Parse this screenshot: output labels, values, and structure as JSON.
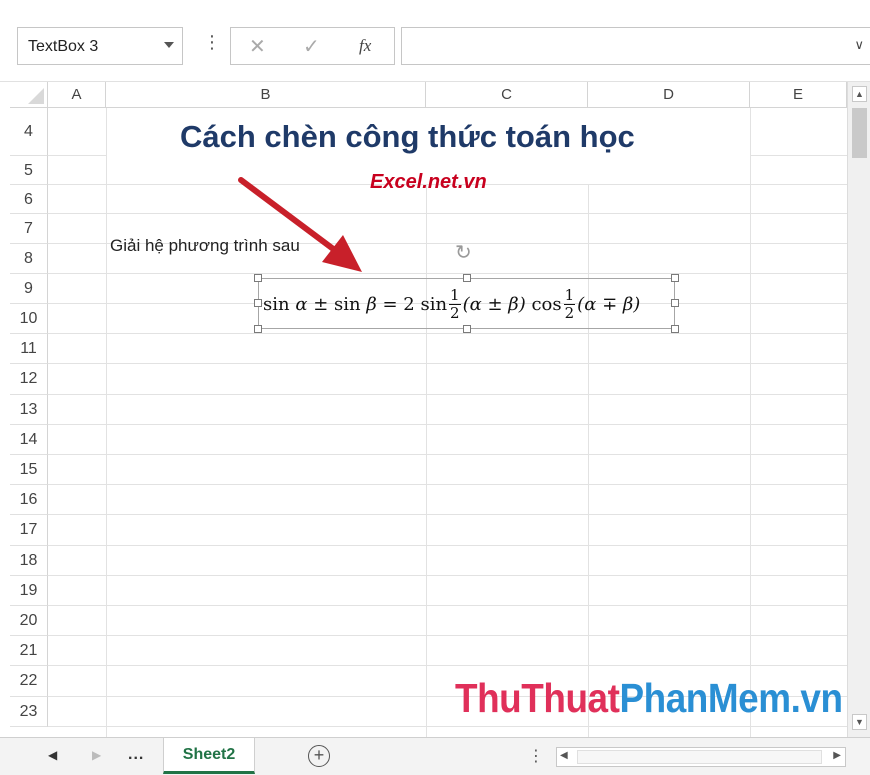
{
  "formula_bar": {
    "name_box": "TextBox 3",
    "dots": "⋮",
    "cancel_icon": "✕",
    "enter_icon": "✓",
    "fx_label": "fx",
    "formula_value": "",
    "expand_icon": "∨"
  },
  "columns": [
    "A",
    "B",
    "C",
    "D",
    "E"
  ],
  "rows": [
    "4",
    "5",
    "6",
    "7",
    "8",
    "9",
    "10",
    "11",
    "12",
    "13",
    "14",
    "15",
    "16",
    "17",
    "18",
    "19",
    "20",
    "21",
    "22",
    "23"
  ],
  "cells": {
    "title": "Cách chèn công thức toán học",
    "subtitle": "Excel.net.vn",
    "b7": "Giải hệ phương trình sau"
  },
  "textbox": {
    "equation": {
      "sin1": "sin",
      "alpha1": "α",
      "pm1": " ± ",
      "sin2": "sin",
      "beta1": "β",
      "eq": " = 2 ",
      "sin3": "sin",
      "frac1_num": "1",
      "frac1_den": "2",
      "paren1": "(α ± β)",
      "cos": "cos",
      "frac2_num": "1",
      "frac2_den": "2",
      "paren2": "(α ∓ β)"
    }
  },
  "sheet_tabs": {
    "prev": "◀",
    "next": "▶",
    "more": "...",
    "active": "Sheet2",
    "add": "+",
    "split": "⋮"
  },
  "watermark": {
    "part1": "ThuThuat",
    "part2": "PhanMem.vn"
  },
  "colors": {
    "title": "#1f3a68",
    "subtitle": "#c8001e",
    "arrow": "#c8202a",
    "active_tab": "#217346"
  }
}
